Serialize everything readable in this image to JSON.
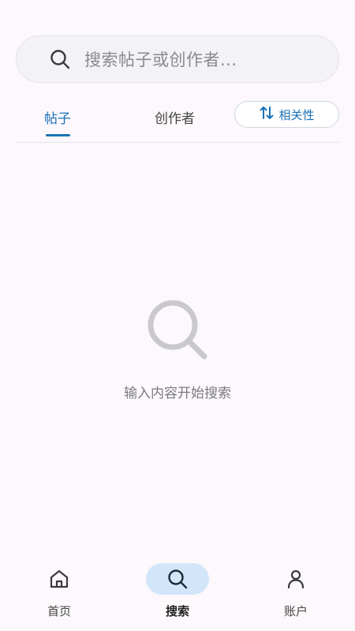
{
  "search": {
    "placeholder": "搜索帖子或创作者..."
  },
  "tabs": [
    {
      "label": "帖子",
      "active": true
    },
    {
      "label": "创作者",
      "active": false
    }
  ],
  "sort": {
    "label": "相关性",
    "icon": "sort-arrows-icon"
  },
  "empty_state": {
    "message": "输入内容开始搜索",
    "icon": "search-icon"
  },
  "bottom_nav": [
    {
      "label": "首页",
      "icon": "home-icon",
      "active": false
    },
    {
      "label": "搜索",
      "icon": "search-icon",
      "active": true
    },
    {
      "label": "账户",
      "icon": "person-icon",
      "active": false
    }
  ],
  "colors": {
    "accent": "#1a72b8",
    "active_pill": "#d2e6fa",
    "background": "#fcf8fc"
  }
}
